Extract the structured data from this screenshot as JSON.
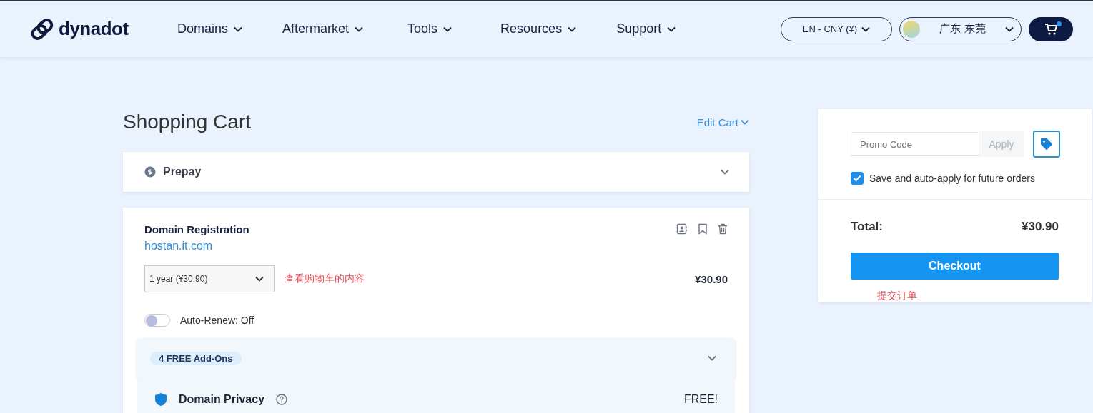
{
  "header": {
    "logo": "dynadot",
    "nav": [
      {
        "label": "Domains"
      },
      {
        "label": "Aftermarket"
      },
      {
        "label": "Tools"
      },
      {
        "label": "Resources"
      },
      {
        "label": "Support"
      }
    ],
    "currency": "EN - CNY (¥)",
    "location": "广东 东莞",
    "cart_notification": true
  },
  "cart": {
    "title": "Shopping Cart",
    "edit": "Edit Cart",
    "prepay": {
      "label": "Prepay",
      "expanded": false
    },
    "item": {
      "type": "Domain Registration",
      "domain": "hostan.it.com",
      "term": "1 year (¥30.90)",
      "annotation": "查看购物车的内容",
      "price": "¥30.90",
      "auto_renew": {
        "label": "Auto-Renew: Off",
        "on": false
      },
      "addons": {
        "badge": "4 FREE Add-Ons",
        "expanded": false,
        "rows": [
          {
            "name": "Domain Privacy",
            "price": "FREE!"
          }
        ]
      }
    }
  },
  "summary": {
    "promo": {
      "placeholder": "Promo Code",
      "apply": "Apply"
    },
    "save_option": {
      "label": "Save and auto-apply for future orders",
      "checked": true
    },
    "total_label": "Total:",
    "total": "¥30.90",
    "checkout": "Checkout",
    "annotation": "提交订单"
  }
}
